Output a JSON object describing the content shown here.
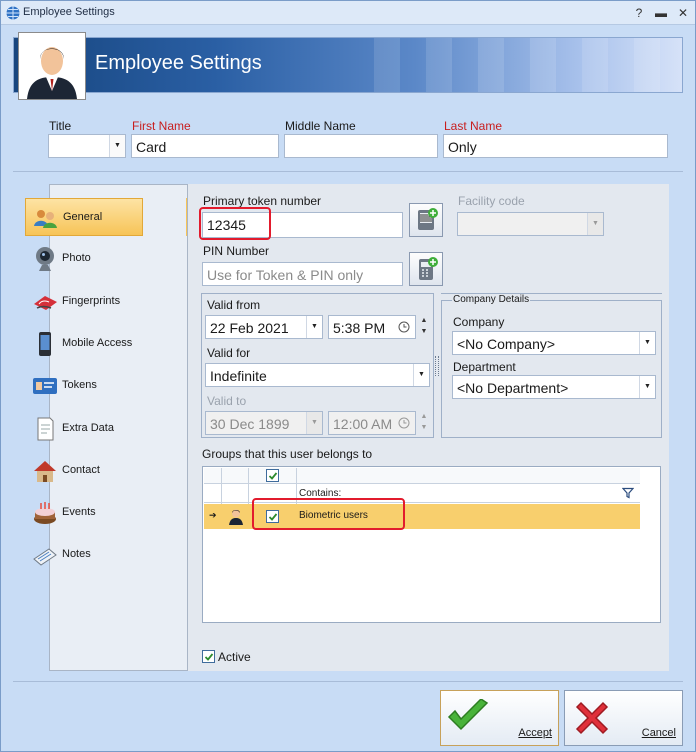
{
  "window": {
    "title": "Employee Settings"
  },
  "header": {
    "title": "Employee Settings"
  },
  "name_fields": {
    "title_label": "Title",
    "first_label": "First Name",
    "first_value": "Card",
    "middle_label": "Middle Name",
    "middle_value": "",
    "last_label": "Last Name",
    "last_value": "Only"
  },
  "nav": [
    {
      "label": "General",
      "icon": "people-icon"
    },
    {
      "label": "Photo",
      "icon": "webcam-icon"
    },
    {
      "label": "Fingerprints",
      "icon": "fingerprint-icon"
    },
    {
      "label": "Mobile Access",
      "icon": "phone-icon"
    },
    {
      "label": "Tokens",
      "icon": "card-icon"
    },
    {
      "label": "Extra Data",
      "icon": "note-icon"
    },
    {
      "label": "Contact",
      "icon": "house-icon"
    },
    {
      "label": "Events",
      "icon": "cake-icon"
    },
    {
      "label": "Notes",
      "icon": "notes-icon"
    }
  ],
  "general": {
    "primary_token_label": "Primary token number",
    "primary_token_value": "12345",
    "facility_code_label": "Facility code",
    "pin_label": "PIN Number",
    "pin_placeholder": "Use for Token & PIN only",
    "valid_from_label": "Valid from",
    "valid_from_date": "22 Feb 2021",
    "valid_from_time": "5:38 PM",
    "valid_for_label": "Valid for",
    "valid_for_value": "Indefinite",
    "valid_to_label": "Valid to",
    "valid_to_date": "30 Dec 1899",
    "valid_to_time": "12:00 AM",
    "company_details_title": "Company Details",
    "company_label": "Company",
    "company_value": "<No Company>",
    "department_label": "Department",
    "department_value": "<No Department>",
    "groups_label": "Groups that this user belongs to",
    "grid_contains_label": "Contains:",
    "group_row_name": "Biometric users",
    "active_label": "Active"
  },
  "buttons": {
    "accept": "Accept",
    "cancel": "Cancel"
  },
  "colors": {
    "accent_highlight": "#f8cf6d",
    "required_label": "#c81e1e",
    "callout": "#e21b2d"
  }
}
